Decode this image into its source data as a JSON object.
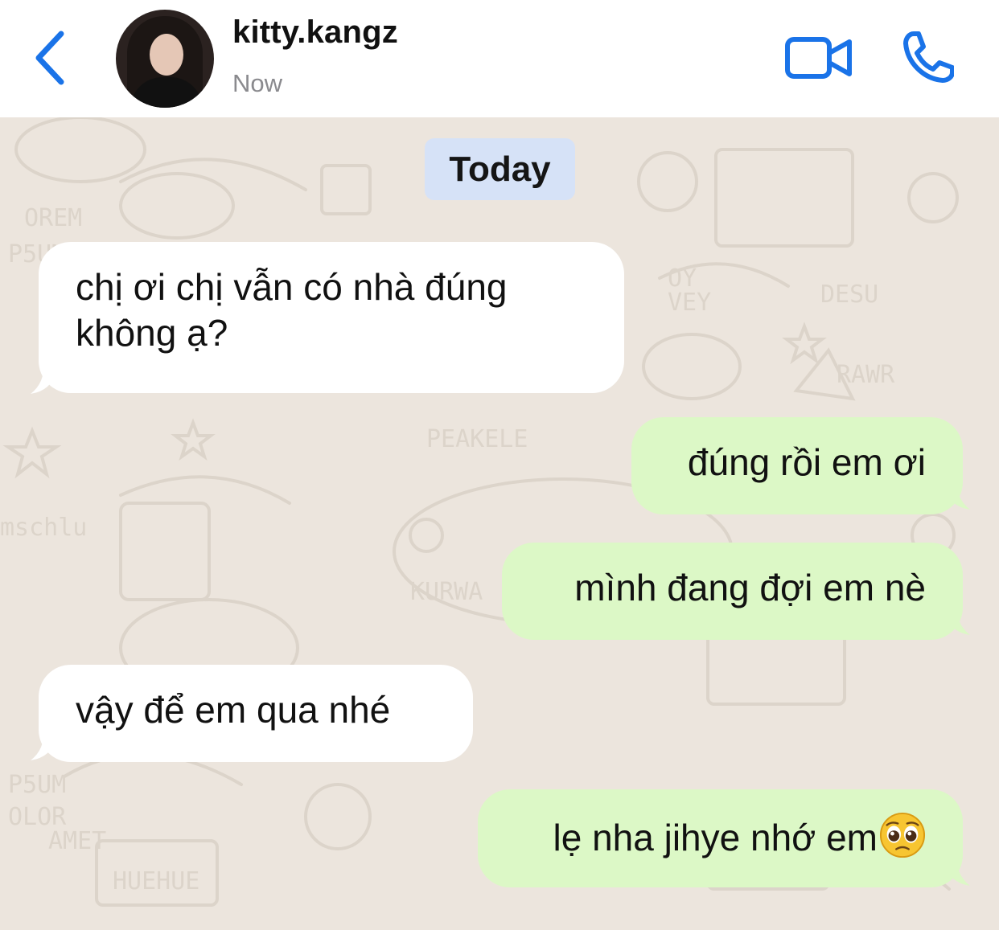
{
  "header": {
    "contact_name": "kitty.kangz",
    "status": "Now",
    "icons": {
      "back": "chevron-left-icon",
      "video": "video-camera-icon",
      "call": "phone-icon"
    },
    "accent_color": "#1a73e8"
  },
  "chat": {
    "date_label": "Today",
    "colors": {
      "incoming_bubble": "#ffffff",
      "outgoing_bubble": "#dcf8c6",
      "date_chip": "#d6e2f7",
      "wallpaper": "#ece5dd"
    },
    "messages": [
      {
        "direction": "incoming",
        "line1": "chị ơi chị vẫn có nhà đúng",
        "line2": "không ạ?"
      },
      {
        "direction": "outgoing",
        "text": "đúng rồi em ơi"
      },
      {
        "direction": "outgoing",
        "text": "mình đang đợi em nè"
      },
      {
        "direction": "incoming",
        "text": "vậy để em qua nhé"
      },
      {
        "direction": "outgoing",
        "text": "lẹ nha jihye nhớ em",
        "emoji": "pleading-face-emoji"
      }
    ]
  }
}
